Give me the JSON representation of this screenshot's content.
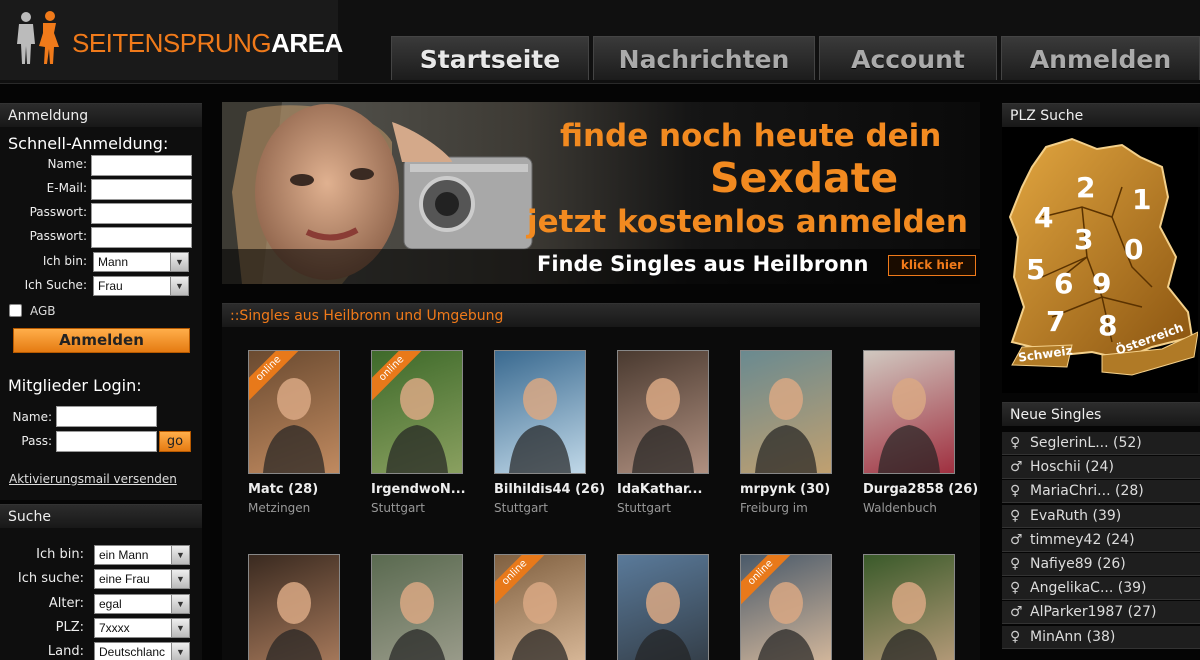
{
  "header": {
    "logo_part1": "SEITENSPRUNG",
    "logo_part2": "AREA",
    "nav": [
      "Startseite",
      "Nachrichten",
      "Account",
      "Anmelden"
    ]
  },
  "signup": {
    "panel_title": "Anmeldung",
    "heading": "Schnell-Anmeldung:",
    "name_label": "Name:",
    "email_label": "E-Mail:",
    "password_label": "Passwort:",
    "password2_label": "Passwort:",
    "iam_label": "Ich bin:",
    "iam_value": "Mann",
    "seek_label": "Ich Suche:",
    "seek_value": "Frau",
    "agb_label": "AGB",
    "submit_label": "Anmelden"
  },
  "login": {
    "heading": "Mitglieder Login:",
    "name_label": "Name:",
    "pass_label": "Pass:",
    "go_label": "go",
    "activation_link": "Aktivierungsmail versenden"
  },
  "search": {
    "panel_title": "Suche",
    "iam_label": "Ich bin:",
    "iam_value": "ein Mann",
    "seek_label": "Ich suche:",
    "seek_value": "eine Frau",
    "age_label": "Alter:",
    "age_value": "egal",
    "plz_label": "PLZ:",
    "plz_value": "7xxxx",
    "country_label": "Land:",
    "country_value": "Deutschlanc"
  },
  "banner": {
    "line1": "finde noch heute  dein",
    "line2": "Sexdate",
    "line3": "jetzt kostenlos anmelden",
    "line4": "Finde Singles aus Heilbronn",
    "button": "klick hier"
  },
  "singles": {
    "heading": "::Singles aus Heilbronn und Umgebung",
    "online_badge": "online",
    "row1": [
      {
        "name": "Matc (28)",
        "city": "Metzingen",
        "online": true
      },
      {
        "name": "IrgendwoN...",
        "city": "Stuttgart",
        "online": true
      },
      {
        "name": "Bilhildis44 (26)",
        "city": "Stuttgart",
        "online": false
      },
      {
        "name": "IdaKathar...",
        "city": "Stuttgart",
        "online": false
      },
      {
        "name": "mrpynk (30)",
        "city": "Freiburg im",
        "online": false
      },
      {
        "name": "Durga2858 (26)",
        "city": "Waldenbuch",
        "online": false
      }
    ],
    "row2": [
      {
        "online": false
      },
      {
        "online": false
      },
      {
        "online": true
      },
      {
        "online": false
      },
      {
        "online": true
      },
      {
        "online": false
      }
    ]
  },
  "plz": {
    "panel_title": "PLZ Suche",
    "regions": [
      "2",
      "1",
      "4",
      "3",
      "0",
      "5",
      "6",
      "9",
      "7",
      "8"
    ],
    "schweiz": "Schweiz",
    "oesterreich": "Österreich"
  },
  "new_singles": {
    "panel_title": "Neue Singles",
    "items": [
      {
        "gender": "♀",
        "text": "SeglerinL... (52)"
      },
      {
        "gender": "♂",
        "text": "Hoschii (24)"
      },
      {
        "gender": "♀",
        "text": "MariaChri... (28)"
      },
      {
        "gender": "♀",
        "text": "EvaRuth (39)"
      },
      {
        "gender": "♂",
        "text": "timmey42 (24)"
      },
      {
        "gender": "♀",
        "text": "Nafiye89 (26)"
      },
      {
        "gender": "♀",
        "text": "AngelikaC... (39)"
      },
      {
        "gender": "♂",
        "text": "AlParker1987 (27)"
      },
      {
        "gender": "♀",
        "text": "MinAnn (38)"
      }
    ]
  },
  "colors": {
    "accent": "#f07a1a",
    "background": "#050505"
  }
}
